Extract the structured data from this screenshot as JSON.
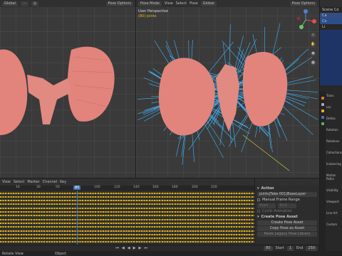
{
  "left_viewport": {
    "header": {
      "mode": "Global",
      "pose_options": "Pose Options"
    }
  },
  "main_viewport": {
    "header": {
      "mode_select": "Pose Mode",
      "menu": [
        "View",
        "Select",
        "Pose"
      ],
      "transform": "Global",
      "pose_options": "Pose Options"
    },
    "view_title": "User Perspective",
    "view_subtitle": "(80) joints"
  },
  "timeline": {
    "header": {
      "menu": [
        "View",
        "Select",
        "Marker",
        "Channel",
        "Key"
      ]
    },
    "ticks": [
      "10",
      "30",
      "50",
      "80",
      "100",
      "120",
      "140",
      "160",
      "180",
      "200",
      "220"
    ],
    "current_frame_label": "80",
    "row_count": 14,
    "keyframe_color": "#e0b21b"
  },
  "action_panel": {
    "action_title": "Action",
    "action_name": "joints|Take 001|BaseLayer",
    "manual_frame_range": "Manual Frame Range",
    "start_label": "Start",
    "end_label": "End",
    "cyclic": "Cyclic Animation",
    "create_pose_asset_title": "Create Pose Asset",
    "create_btn": "Create Pose Asset",
    "copy_btn": "Copy Pose as Asset",
    "paste_btn": "Paste Legacy Pose Library"
  },
  "playback": {
    "frame": "80",
    "start": "1",
    "end": "250"
  },
  "status": {
    "left": "Rotate View",
    "mid": "Object"
  },
  "outliner": {
    "items": [
      "Scene Co",
      "Ca",
      "Co",
      "Li"
    ]
  },
  "properties": {
    "items": [
      "Trans",
      "Loc",
      "Deltas",
      "Rotation",
      "Relations",
      "Collections",
      "Instancing",
      "Motion Paths",
      "Visibility",
      "Viewport",
      "Line Art",
      "Custom"
    ]
  },
  "colors": {
    "accent": "#4772b3",
    "keyframe": "#e0b21b",
    "playhead": "#4772b3",
    "bone": "#3fb7ff",
    "mesh": "#e3847c"
  }
}
